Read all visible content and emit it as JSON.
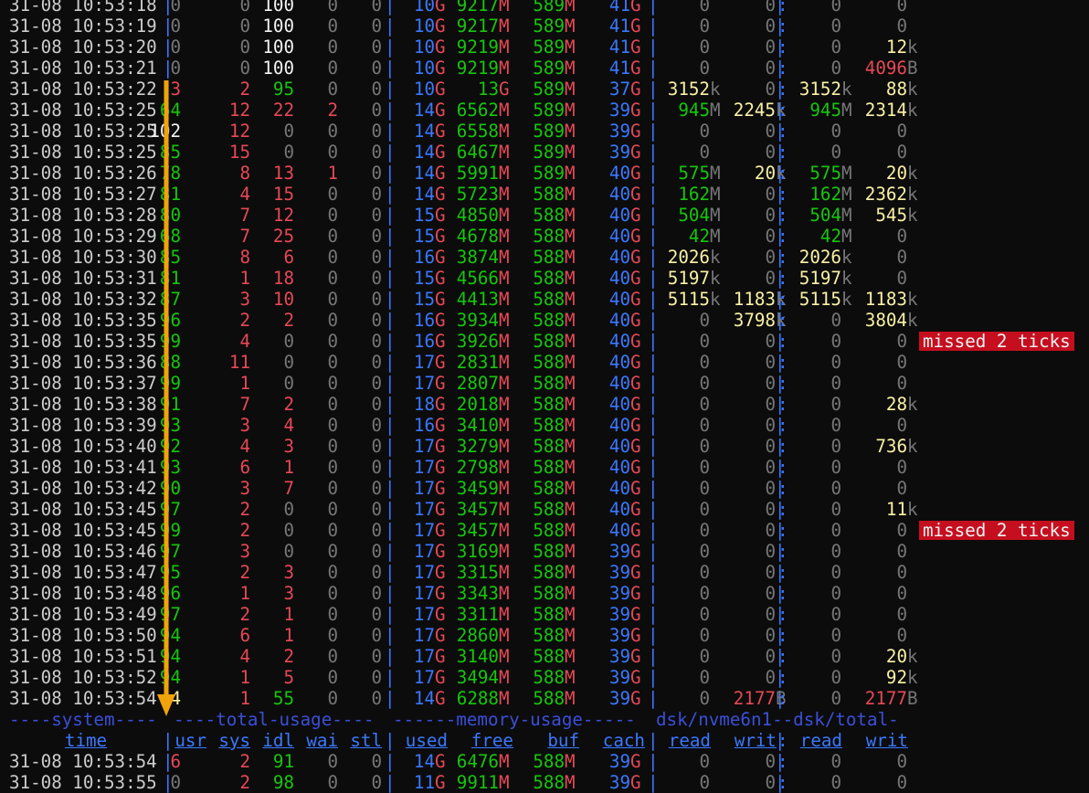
{
  "colors": {
    "timestamp": "#cccccc",
    "white": "#f2f2f2",
    "grey": "#767676",
    "red": "#e74856",
    "green": "#16c60c",
    "yellow": "#f9f1a5",
    "blue": "#3b78ff",
    "header": "#3b4fd8",
    "badge_bg": "#c50f1f",
    "arrow": "#f0a30a"
  },
  "header_groups": [
    "----system----",
    "----total-usage----",
    "------memory-usage-----",
    "dsk/nvme6n1--dsk/total-"
  ],
  "headers": [
    "time",
    "usr",
    "sys",
    "idl",
    "wai",
    "stl",
    "used",
    "free",
    "buf",
    "cach",
    "read",
    "writ",
    "read",
    "writ"
  ],
  "badge_text": "missed 2 ticks",
  "rows": [
    {
      "t": "31-08 10:53:18",
      "usr": "0",
      "sys": "0",
      "idl": "100",
      "wai": "0",
      "stl": "0",
      "used": "10",
      "used_u": "G",
      "free": "9217",
      "free_u": "M",
      "buf": "589",
      "buf_u": "M",
      "cach": "41",
      "cach_u": "G",
      "r1": "0",
      "r1_u": "",
      "w1": "0",
      "w1_u": "",
      "r2": "0",
      "r2_u": "",
      "w2": "0",
      "w2_u": ""
    },
    {
      "t": "31-08 10:53:19",
      "usr": "0",
      "sys": "0",
      "idl": "100",
      "wai": "0",
      "stl": "0",
      "used": "10",
      "used_u": "G",
      "free": "9217",
      "free_u": "M",
      "buf": "589",
      "buf_u": "M",
      "cach": "41",
      "cach_u": "G",
      "r1": "0",
      "r1_u": "",
      "w1": "0",
      "w1_u": "",
      "r2": "0",
      "r2_u": "",
      "w2": "0",
      "w2_u": ""
    },
    {
      "t": "31-08 10:53:20",
      "usr": "0",
      "sys": "0",
      "idl": "100",
      "wai": "0",
      "stl": "0",
      "used": "10",
      "used_u": "G",
      "free": "9219",
      "free_u": "M",
      "buf": "589",
      "buf_u": "M",
      "cach": "41",
      "cach_u": "G",
      "r1": "0",
      "r1_u": "",
      "w1": "0",
      "w1_u": "",
      "r2": "0",
      "r2_u": "",
      "w2": "12",
      "w2_u": "k"
    },
    {
      "t": "31-08 10:53:21",
      "usr": "0",
      "sys": "0",
      "idl": "100",
      "wai": "0",
      "stl": "0",
      "used": "10",
      "used_u": "G",
      "free": "9219",
      "free_u": "M",
      "buf": "589",
      "buf_u": "M",
      "cach": "41",
      "cach_u": "G",
      "r1": "0",
      "r1_u": "",
      "w1": "0",
      "w1_u": "",
      "r2": "0",
      "r2_u": "",
      "w2": "4096",
      "w2_u": "B"
    },
    {
      "t": "31-08 10:53:22",
      "usr": "3",
      "sys": "2",
      "idl": "95",
      "wai": "0",
      "stl": "0",
      "used": "10",
      "used_u": "G",
      "free": "13",
      "free_u": "G",
      "buf": "589",
      "buf_u": "M",
      "cach": "37",
      "cach_u": "G",
      "r1": "3152",
      "r1_u": "k",
      "w1": "0",
      "w1_u": "",
      "r2": "3152",
      "r2_u": "k",
      "w2": "88",
      "w2_u": "k"
    },
    {
      "t": "31-08 10:53:25",
      "usr": "64",
      "sys": "12",
      "idl": "22",
      "wai": "2",
      "stl": "0",
      "used": "14",
      "used_u": "G",
      "free": "6562",
      "free_u": "M",
      "buf": "589",
      "buf_u": "M",
      "cach": "39",
      "cach_u": "G",
      "r1": "945",
      "r1_u": "M",
      "w1": "2245",
      "w1_u": "k",
      "r2": "945",
      "r2_u": "M",
      "w2": "2314",
      "w2_u": "k"
    },
    {
      "t": "31-08 10:53:25",
      "usr": "102",
      "sys": "12",
      "idl": "0",
      "wai": "0",
      "stl": "0",
      "used": "14",
      "used_u": "G",
      "free": "6558",
      "free_u": "M",
      "buf": "589",
      "buf_u": "M",
      "cach": "39",
      "cach_u": "G",
      "r1": "0",
      "r1_u": "",
      "w1": "0",
      "w1_u": "",
      "r2": "0",
      "r2_u": "",
      "w2": "0",
      "w2_u": ""
    },
    {
      "t": "31-08 10:53:25",
      "usr": "85",
      "sys": "15",
      "idl": "0",
      "wai": "0",
      "stl": "0",
      "used": "14",
      "used_u": "G",
      "free": "6467",
      "free_u": "M",
      "buf": "589",
      "buf_u": "M",
      "cach": "39",
      "cach_u": "G",
      "r1": "0",
      "r1_u": "",
      "w1": "0",
      "w1_u": "",
      "r2": "0",
      "r2_u": "",
      "w2": "0",
      "w2_u": ""
    },
    {
      "t": "31-08 10:53:26",
      "usr": "78",
      "sys": "8",
      "idl": "13",
      "wai": "1",
      "stl": "0",
      "used": "14",
      "used_u": "G",
      "free": "5991",
      "free_u": "M",
      "buf": "589",
      "buf_u": "M",
      "cach": "40",
      "cach_u": "G",
      "r1": "575",
      "r1_u": "M",
      "w1": "20",
      "w1_u": "k",
      "r2": "575",
      "r2_u": "M",
      "w2": "20",
      "w2_u": "k"
    },
    {
      "t": "31-08 10:53:27",
      "usr": "81",
      "sys": "4",
      "idl": "15",
      "wai": "0",
      "stl": "0",
      "used": "14",
      "used_u": "G",
      "free": "5723",
      "free_u": "M",
      "buf": "588",
      "buf_u": "M",
      "cach": "40",
      "cach_u": "G",
      "r1": "162",
      "r1_u": "M",
      "w1": "0",
      "w1_u": "",
      "r2": "162",
      "r2_u": "M",
      "w2": "2362",
      "w2_u": "k"
    },
    {
      "t": "31-08 10:53:28",
      "usr": "80",
      "sys": "7",
      "idl": "12",
      "wai": "0",
      "stl": "0",
      "used": "15",
      "used_u": "G",
      "free": "4850",
      "free_u": "M",
      "buf": "588",
      "buf_u": "M",
      "cach": "40",
      "cach_u": "G",
      "r1": "504",
      "r1_u": "M",
      "w1": "0",
      "w1_u": "",
      "r2": "504",
      "r2_u": "M",
      "w2": "545",
      "w2_u": "k"
    },
    {
      "t": "31-08 10:53:29",
      "usr": "68",
      "sys": "7",
      "idl": "25",
      "wai": "0",
      "stl": "0",
      "used": "15",
      "used_u": "G",
      "free": "4678",
      "free_u": "M",
      "buf": "588",
      "buf_u": "M",
      "cach": "40",
      "cach_u": "G",
      "r1": "42",
      "r1_u": "M",
      "w1": "0",
      "w1_u": "",
      "r2": "42",
      "r2_u": "M",
      "w2": "0",
      "w2_u": ""
    },
    {
      "t": "31-08 10:53:30",
      "usr": "85",
      "sys": "8",
      "idl": "6",
      "wai": "0",
      "stl": "0",
      "used": "16",
      "used_u": "G",
      "free": "3874",
      "free_u": "M",
      "buf": "588",
      "buf_u": "M",
      "cach": "40",
      "cach_u": "G",
      "r1": "2026",
      "r1_u": "k",
      "w1": "0",
      "w1_u": "",
      "r2": "2026",
      "r2_u": "k",
      "w2": "0",
      "w2_u": ""
    },
    {
      "t": "31-08 10:53:31",
      "usr": "81",
      "sys": "1",
      "idl": "18",
      "wai": "0",
      "stl": "0",
      "used": "15",
      "used_u": "G",
      "free": "4566",
      "free_u": "M",
      "buf": "588",
      "buf_u": "M",
      "cach": "40",
      "cach_u": "G",
      "r1": "5197",
      "r1_u": "k",
      "w1": "0",
      "w1_u": "",
      "r2": "5197",
      "r2_u": "k",
      "w2": "0",
      "w2_u": ""
    },
    {
      "t": "31-08 10:53:32",
      "usr": "87",
      "sys": "3",
      "idl": "10",
      "wai": "0",
      "stl": "0",
      "used": "15",
      "used_u": "G",
      "free": "4413",
      "free_u": "M",
      "buf": "588",
      "buf_u": "M",
      "cach": "40",
      "cach_u": "G",
      "r1": "5115",
      "r1_u": "k",
      "w1": "1183",
      "w1_u": "k",
      "r2": "5115",
      "r2_u": "k",
      "w2": "1183",
      "w2_u": "k"
    },
    {
      "t": "31-08 10:53:35",
      "usr": "96",
      "sys": "2",
      "idl": "2",
      "wai": "0",
      "stl": "0",
      "used": "16",
      "used_u": "G",
      "free": "3934",
      "free_u": "M",
      "buf": "588",
      "buf_u": "M",
      "cach": "40",
      "cach_u": "G",
      "r1": "0",
      "r1_u": "",
      "w1": "3798",
      "w1_u": "k",
      "r2": "0",
      "r2_u": "",
      "w2": "3804",
      "w2_u": "k"
    },
    {
      "t": "31-08 10:53:35",
      "usr": "99",
      "sys": "4",
      "idl": "0",
      "wai": "0",
      "stl": "0",
      "used": "16",
      "used_u": "G",
      "free": "3926",
      "free_u": "M",
      "buf": "588",
      "buf_u": "M",
      "cach": "40",
      "cach_u": "G",
      "r1": "0",
      "r1_u": "",
      "w1": "0",
      "w1_u": "",
      "r2": "0",
      "r2_u": "",
      "w2": "0",
      "w2_u": "",
      "badge": true
    },
    {
      "t": "31-08 10:53:36",
      "usr": "88",
      "sys": "11",
      "idl": "0",
      "wai": "0",
      "stl": "0",
      "used": "17",
      "used_u": "G",
      "free": "2831",
      "free_u": "M",
      "buf": "588",
      "buf_u": "M",
      "cach": "40",
      "cach_u": "G",
      "r1": "0",
      "r1_u": "",
      "w1": "0",
      "w1_u": "",
      "r2": "0",
      "r2_u": "",
      "w2": "0",
      "w2_u": ""
    },
    {
      "t": "31-08 10:53:37",
      "usr": "99",
      "sys": "1",
      "idl": "0",
      "wai": "0",
      "stl": "0",
      "used": "17",
      "used_u": "G",
      "free": "2807",
      "free_u": "M",
      "buf": "588",
      "buf_u": "M",
      "cach": "40",
      "cach_u": "G",
      "r1": "0",
      "r1_u": "",
      "w1": "0",
      "w1_u": "",
      "r2": "0",
      "r2_u": "",
      "w2": "0",
      "w2_u": ""
    },
    {
      "t": "31-08 10:53:38",
      "usr": "91",
      "sys": "7",
      "idl": "2",
      "wai": "0",
      "stl": "0",
      "used": "18",
      "used_u": "G",
      "free": "2018",
      "free_u": "M",
      "buf": "588",
      "buf_u": "M",
      "cach": "40",
      "cach_u": "G",
      "r1": "0",
      "r1_u": "",
      "w1": "0",
      "w1_u": "",
      "r2": "0",
      "r2_u": "",
      "w2": "28",
      "w2_u": "k"
    },
    {
      "t": "31-08 10:53:39",
      "usr": "93",
      "sys": "3",
      "idl": "4",
      "wai": "0",
      "stl": "0",
      "used": "16",
      "used_u": "G",
      "free": "3410",
      "free_u": "M",
      "buf": "588",
      "buf_u": "M",
      "cach": "40",
      "cach_u": "G",
      "r1": "0",
      "r1_u": "",
      "w1": "0",
      "w1_u": "",
      "r2": "0",
      "r2_u": "",
      "w2": "0",
      "w2_u": ""
    },
    {
      "t": "31-08 10:53:40",
      "usr": "92",
      "sys": "4",
      "idl": "3",
      "wai": "0",
      "stl": "0",
      "used": "17",
      "used_u": "G",
      "free": "3279",
      "free_u": "M",
      "buf": "588",
      "buf_u": "M",
      "cach": "40",
      "cach_u": "G",
      "r1": "0",
      "r1_u": "",
      "w1": "0",
      "w1_u": "",
      "r2": "0",
      "r2_u": "",
      "w2": "736",
      "w2_u": "k"
    },
    {
      "t": "31-08 10:53:41",
      "usr": "93",
      "sys": "6",
      "idl": "1",
      "wai": "0",
      "stl": "0",
      "used": "17",
      "used_u": "G",
      "free": "2798",
      "free_u": "M",
      "buf": "588",
      "buf_u": "M",
      "cach": "40",
      "cach_u": "G",
      "r1": "0",
      "r1_u": "",
      "w1": "0",
      "w1_u": "",
      "r2": "0",
      "r2_u": "",
      "w2": "0",
      "w2_u": ""
    },
    {
      "t": "31-08 10:53:42",
      "usr": "90",
      "sys": "3",
      "idl": "7",
      "wai": "0",
      "stl": "0",
      "used": "17",
      "used_u": "G",
      "free": "3459",
      "free_u": "M",
      "buf": "588",
      "buf_u": "M",
      "cach": "40",
      "cach_u": "G",
      "r1": "0",
      "r1_u": "",
      "w1": "0",
      "w1_u": "",
      "r2": "0",
      "r2_u": "",
      "w2": "0",
      "w2_u": ""
    },
    {
      "t": "31-08 10:53:45",
      "usr": "97",
      "sys": "2",
      "idl": "0",
      "wai": "0",
      "stl": "0",
      "used": "17",
      "used_u": "G",
      "free": "3457",
      "free_u": "M",
      "buf": "588",
      "buf_u": "M",
      "cach": "40",
      "cach_u": "G",
      "r1": "0",
      "r1_u": "",
      "w1": "0",
      "w1_u": "",
      "r2": "0",
      "r2_u": "",
      "w2": "11",
      "w2_u": "k"
    },
    {
      "t": "31-08 10:53:45",
      "usr": "99",
      "sys": "2",
      "idl": "0",
      "wai": "0",
      "stl": "0",
      "used": "17",
      "used_u": "G",
      "free": "3457",
      "free_u": "M",
      "buf": "588",
      "buf_u": "M",
      "cach": "40",
      "cach_u": "G",
      "r1": "0",
      "r1_u": "",
      "w1": "0",
      "w1_u": "",
      "r2": "0",
      "r2_u": "",
      "w2": "0",
      "w2_u": "",
      "badge": true
    },
    {
      "t": "31-08 10:53:46",
      "usr": "97",
      "sys": "3",
      "idl": "0",
      "wai": "0",
      "stl": "0",
      "used": "17",
      "used_u": "G",
      "free": "3169",
      "free_u": "M",
      "buf": "588",
      "buf_u": "M",
      "cach": "39",
      "cach_u": "G",
      "r1": "0",
      "r1_u": "",
      "w1": "0",
      "w1_u": "",
      "r2": "0",
      "r2_u": "",
      "w2": "0",
      "w2_u": ""
    },
    {
      "t": "31-08 10:53:47",
      "usr": "95",
      "sys": "2",
      "idl": "3",
      "wai": "0",
      "stl": "0",
      "used": "17",
      "used_u": "G",
      "free": "3315",
      "free_u": "M",
      "buf": "588",
      "buf_u": "M",
      "cach": "39",
      "cach_u": "G",
      "r1": "0",
      "r1_u": "",
      "w1": "0",
      "w1_u": "",
      "r2": "0",
      "r2_u": "",
      "w2": "0",
      "w2_u": ""
    },
    {
      "t": "31-08 10:53:48",
      "usr": "96",
      "sys": "1",
      "idl": "3",
      "wai": "0",
      "stl": "0",
      "used": "17",
      "used_u": "G",
      "free": "3343",
      "free_u": "M",
      "buf": "588",
      "buf_u": "M",
      "cach": "39",
      "cach_u": "G",
      "r1": "0",
      "r1_u": "",
      "w1": "0",
      "w1_u": "",
      "r2": "0",
      "r2_u": "",
      "w2": "0",
      "w2_u": ""
    },
    {
      "t": "31-08 10:53:49",
      "usr": "97",
      "sys": "2",
      "idl": "1",
      "wai": "0",
      "stl": "0",
      "used": "17",
      "used_u": "G",
      "free": "3311",
      "free_u": "M",
      "buf": "588",
      "buf_u": "M",
      "cach": "39",
      "cach_u": "G",
      "r1": "0",
      "r1_u": "",
      "w1": "0",
      "w1_u": "",
      "r2": "0",
      "r2_u": "",
      "w2": "0",
      "w2_u": ""
    },
    {
      "t": "31-08 10:53:50",
      "usr": "94",
      "sys": "6",
      "idl": "1",
      "wai": "0",
      "stl": "0",
      "used": "17",
      "used_u": "G",
      "free": "2860",
      "free_u": "M",
      "buf": "588",
      "buf_u": "M",
      "cach": "39",
      "cach_u": "G",
      "r1": "0",
      "r1_u": "",
      "w1": "0",
      "w1_u": "",
      "r2": "0",
      "r2_u": "",
      "w2": "0",
      "w2_u": ""
    },
    {
      "t": "31-08 10:53:51",
      "usr": "94",
      "sys": "4",
      "idl": "2",
      "wai": "0",
      "stl": "0",
      "used": "17",
      "used_u": "G",
      "free": "3140",
      "free_u": "M",
      "buf": "588",
      "buf_u": "M",
      "cach": "39",
      "cach_u": "G",
      "r1": "0",
      "r1_u": "",
      "w1": "0",
      "w1_u": "",
      "r2": "0",
      "r2_u": "",
      "w2": "20",
      "w2_u": "k"
    },
    {
      "t": "31-08 10:53:52",
      "usr": "94",
      "sys": "1",
      "idl": "5",
      "wai": "0",
      "stl": "0",
      "used": "17",
      "used_u": "G",
      "free": "3494",
      "free_u": "M",
      "buf": "588",
      "buf_u": "M",
      "cach": "39",
      "cach_u": "G",
      "r1": "0",
      "r1_u": "",
      "w1": "0",
      "w1_u": "",
      "r2": "0",
      "r2_u": "",
      "w2": "92",
      "w2_u": "k"
    },
    {
      "t": "31-08 10:53:54",
      "usr": "44",
      "sys": "1",
      "idl": "55",
      "wai": "0",
      "stl": "0",
      "used": "14",
      "used_u": "G",
      "free": "6288",
      "free_u": "M",
      "buf": "588",
      "buf_u": "M",
      "cach": "39",
      "cach_u": "G",
      "r1": "0",
      "r1_u": "",
      "w1": "2177",
      "w1_u": "B",
      "r2": "0",
      "r2_u": "",
      "w2": "2177",
      "w2_u": "B"
    }
  ],
  "rows_after": [
    {
      "t": "31-08 10:53:54",
      "usr": "6",
      "sys": "2",
      "idl": "91",
      "wai": "0",
      "stl": "0",
      "used": "14",
      "used_u": "G",
      "free": "6476",
      "free_u": "M",
      "buf": "588",
      "buf_u": "M",
      "cach": "39",
      "cach_u": "G",
      "r1": "0",
      "r1_u": "",
      "w1": "0",
      "w1_u": "",
      "r2": "0",
      "r2_u": "",
      "w2": "0",
      "w2_u": ""
    },
    {
      "t": "31-08 10:53:55",
      "usr": "0",
      "sys": "2",
      "idl": "98",
      "wai": "0",
      "stl": "0",
      "used": "11",
      "used_u": "G",
      "free": "9911",
      "free_u": "M",
      "buf": "588",
      "buf_u": "M",
      "cach": "39",
      "cach_u": "G",
      "r1": "0",
      "r1_u": "",
      "w1": "0",
      "w1_u": "",
      "r2": "0",
      "r2_u": "",
      "w2": "0",
      "w2_u": ""
    }
  ]
}
